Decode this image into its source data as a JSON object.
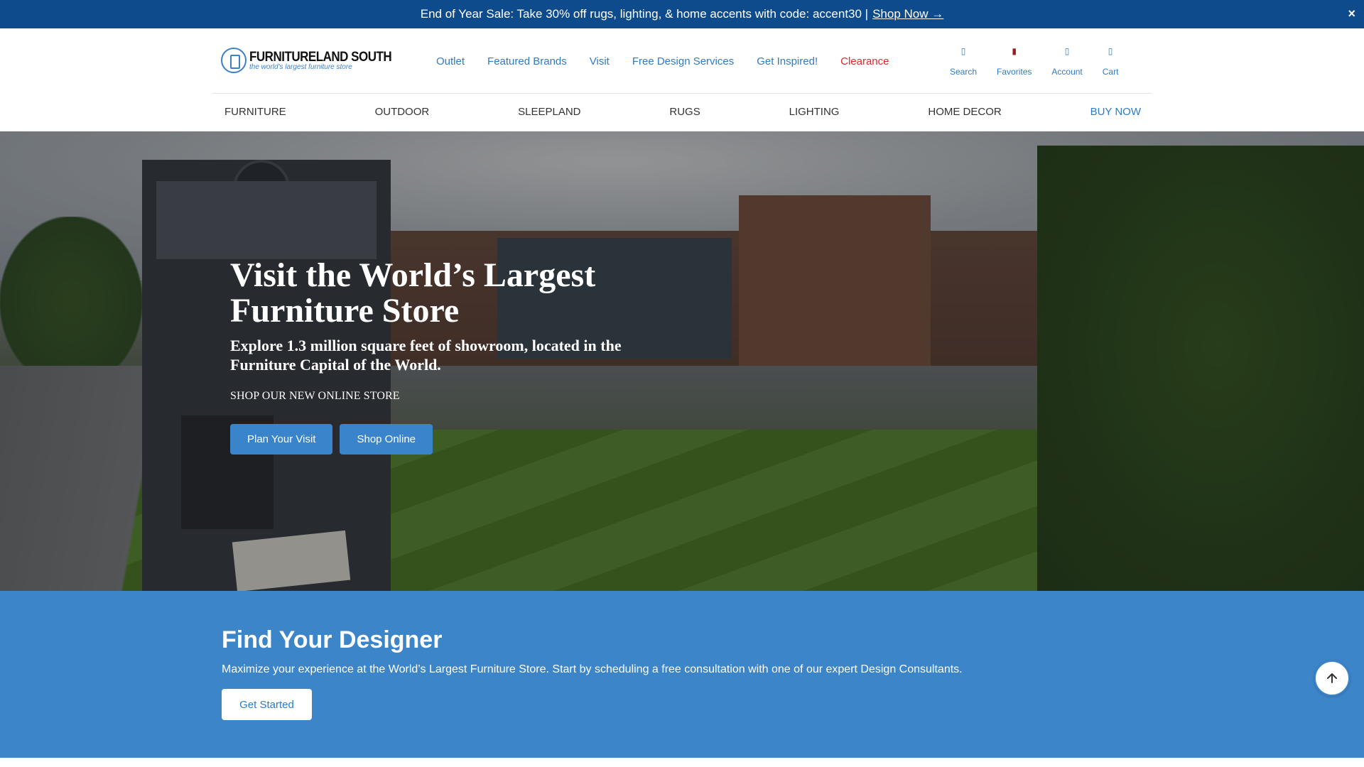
{
  "promo": {
    "text": "End of Year Sale: Take 30% off rugs, lighting, & home accents with code: accent30 |",
    "link": "Shop Now →",
    "close": "×"
  },
  "logo": {
    "name": "FURNITURELAND SOUTH",
    "tagline": "the world's largest furniture store"
  },
  "topnav": {
    "items": [
      "Outlet",
      "Featured Brands",
      "Visit",
      "Free Design Services",
      "Get Inspired!",
      "Clearance"
    ]
  },
  "header_icons": {
    "items": [
      {
        "label": "Search",
        "icon": "search-icon"
      },
      {
        "label": "Favorites",
        "icon": "heart-icon"
      },
      {
        "label": "Account",
        "icon": "user-icon"
      },
      {
        "label": "Cart",
        "icon": "cart-icon"
      }
    ]
  },
  "catnav": {
    "items": [
      "FURNITURE",
      "OUTDOOR",
      "SLEEPLAND",
      "RUGS",
      "LIGHTING",
      "HOME DECOR",
      "BUY NOW"
    ]
  },
  "hero": {
    "title": "Visit the World’s Largest Furniture Store",
    "subtitle": "Explore 1.3 million square feet of showroom, located in the Furniture Capital of the World.",
    "shop_line": "SHOP OUR NEW ONLINE STORE",
    "primary_button": "Plan Your Visit",
    "secondary_button": "Shop Online"
  },
  "designer": {
    "title": "Find Your Designer",
    "text": "Maximize your experience at the World’s Largest Furniture Store. Start by scheduling a free consultation with one of our expert Design Consultants.",
    "button": "Get Started"
  },
  "colors": {
    "promo_bg": "#0e4b8c",
    "link_blue": "#2e7bc6",
    "clearance_red": "#d92b2b",
    "section_blue": "#3d85c9"
  }
}
